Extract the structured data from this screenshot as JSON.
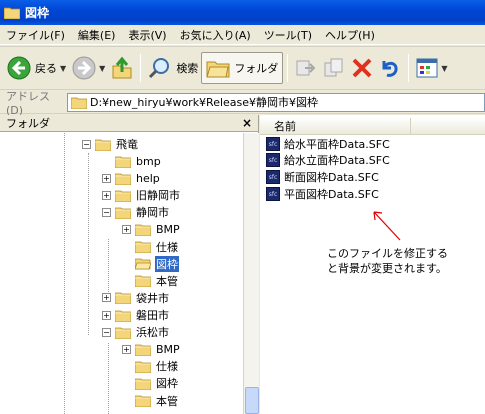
{
  "window": {
    "title": "図枠"
  },
  "menu": [
    "ファイル(F)",
    "編集(E)",
    "表示(V)",
    "お気に入り(A)",
    "ツール(T)",
    "ヘルプ(H)"
  ],
  "toolbar": {
    "back": "戻る",
    "search": "検索",
    "folders": "フォルダ"
  },
  "address": {
    "label": "アドレス(D)",
    "path": "D:¥new_hiryu¥work¥Release¥静岡市¥図枠"
  },
  "folder_pane": {
    "title": "フォルダ",
    "close": "×",
    "tree": [
      {
        "label": "飛竜",
        "expander": "-"
      },
      {
        "label": "bmp",
        "expander": ""
      },
      {
        "label": "help",
        "expander": "+"
      },
      {
        "label": "旧静岡市",
        "expander": "+"
      },
      {
        "label": "静岡市",
        "expander": "-"
      },
      {
        "label": "BMP",
        "expander": "+"
      },
      {
        "label": "仕様",
        "expander": ""
      },
      {
        "label": "図枠",
        "expander": "",
        "selected": true
      },
      {
        "label": "本管",
        "expander": ""
      },
      {
        "label": "袋井市",
        "expander": "+"
      },
      {
        "label": "磐田市",
        "expander": "+"
      },
      {
        "label": "浜松市",
        "expander": "-"
      },
      {
        "label": "BMP",
        "expander": "+"
      },
      {
        "label": "仕様",
        "expander": ""
      },
      {
        "label": "図枠",
        "expander": ""
      },
      {
        "label": "本管",
        "expander": ""
      }
    ]
  },
  "file_pane": {
    "column_name": "名前",
    "files": [
      "給水平面枠Data.SFC",
      "給水立面枠Data.SFC",
      "断面図枠Data.SFC",
      "平面図枠Data.SFC"
    ],
    "file_icon_text": "sfc"
  },
  "annotation": {
    "line1": "このファイルを修正する",
    "line2": "と背景が変更されます。",
    "arrow_color": "#e00000"
  },
  "colors": {
    "title_bar": "#0046d5",
    "selection": "#316ac5",
    "folder": "#f3d67a"
  }
}
